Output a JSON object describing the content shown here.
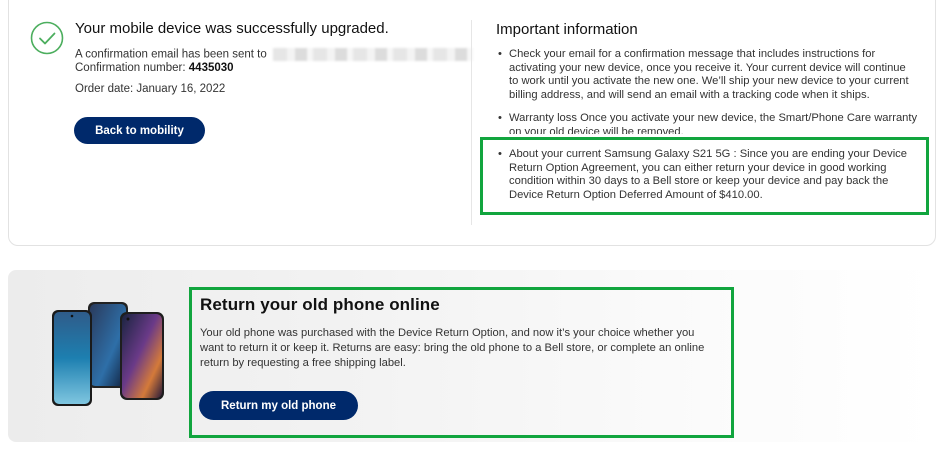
{
  "confirmation": {
    "title": "Your mobile device was successfully upgraded.",
    "email_prefix": "A confirmation email has been sent to",
    "confirmation_label": "Confirmation number:",
    "confirmation_number": "4435030",
    "order_date": "Order date: January 16, 2022",
    "back_button": "Back to mobility",
    "icon": "check-circle-icon",
    "accent_color": "#4cae5e"
  },
  "important_info": {
    "title": "Important information",
    "items": [
      "Check your email for a confirmation message that includes instructions for activating your new device, once you receive it. Your current device will continue to work until you activate the new one. We’ll ship your new device to your current billing address, and will send an email with a tracking code when it ships.",
      "Warranty loss Once you activate your new device, the Smart/Phone Care warranty on your old device will be removed.",
      "About your current Samsung Galaxy S21 5G : Since you are ending your Device Return Option Agreement, you can either return your device in good working condition within 30 days to a Bell store or keep your device and pay back the Device Return Option Deferred Amount of $410.00."
    ]
  },
  "return_section": {
    "title": "Return your old phone online",
    "text": "Your old phone was purchased with the Device Return Option, and now it’s your choice whether you want to return it or keep it. Returns are easy: bring the old phone to a Bell store, or complete an online return by requesting a free shipping label.",
    "button": "Return my old phone",
    "image": "phones-image"
  },
  "colors": {
    "primary_button": "#00296b",
    "highlight": "#11a53e"
  }
}
